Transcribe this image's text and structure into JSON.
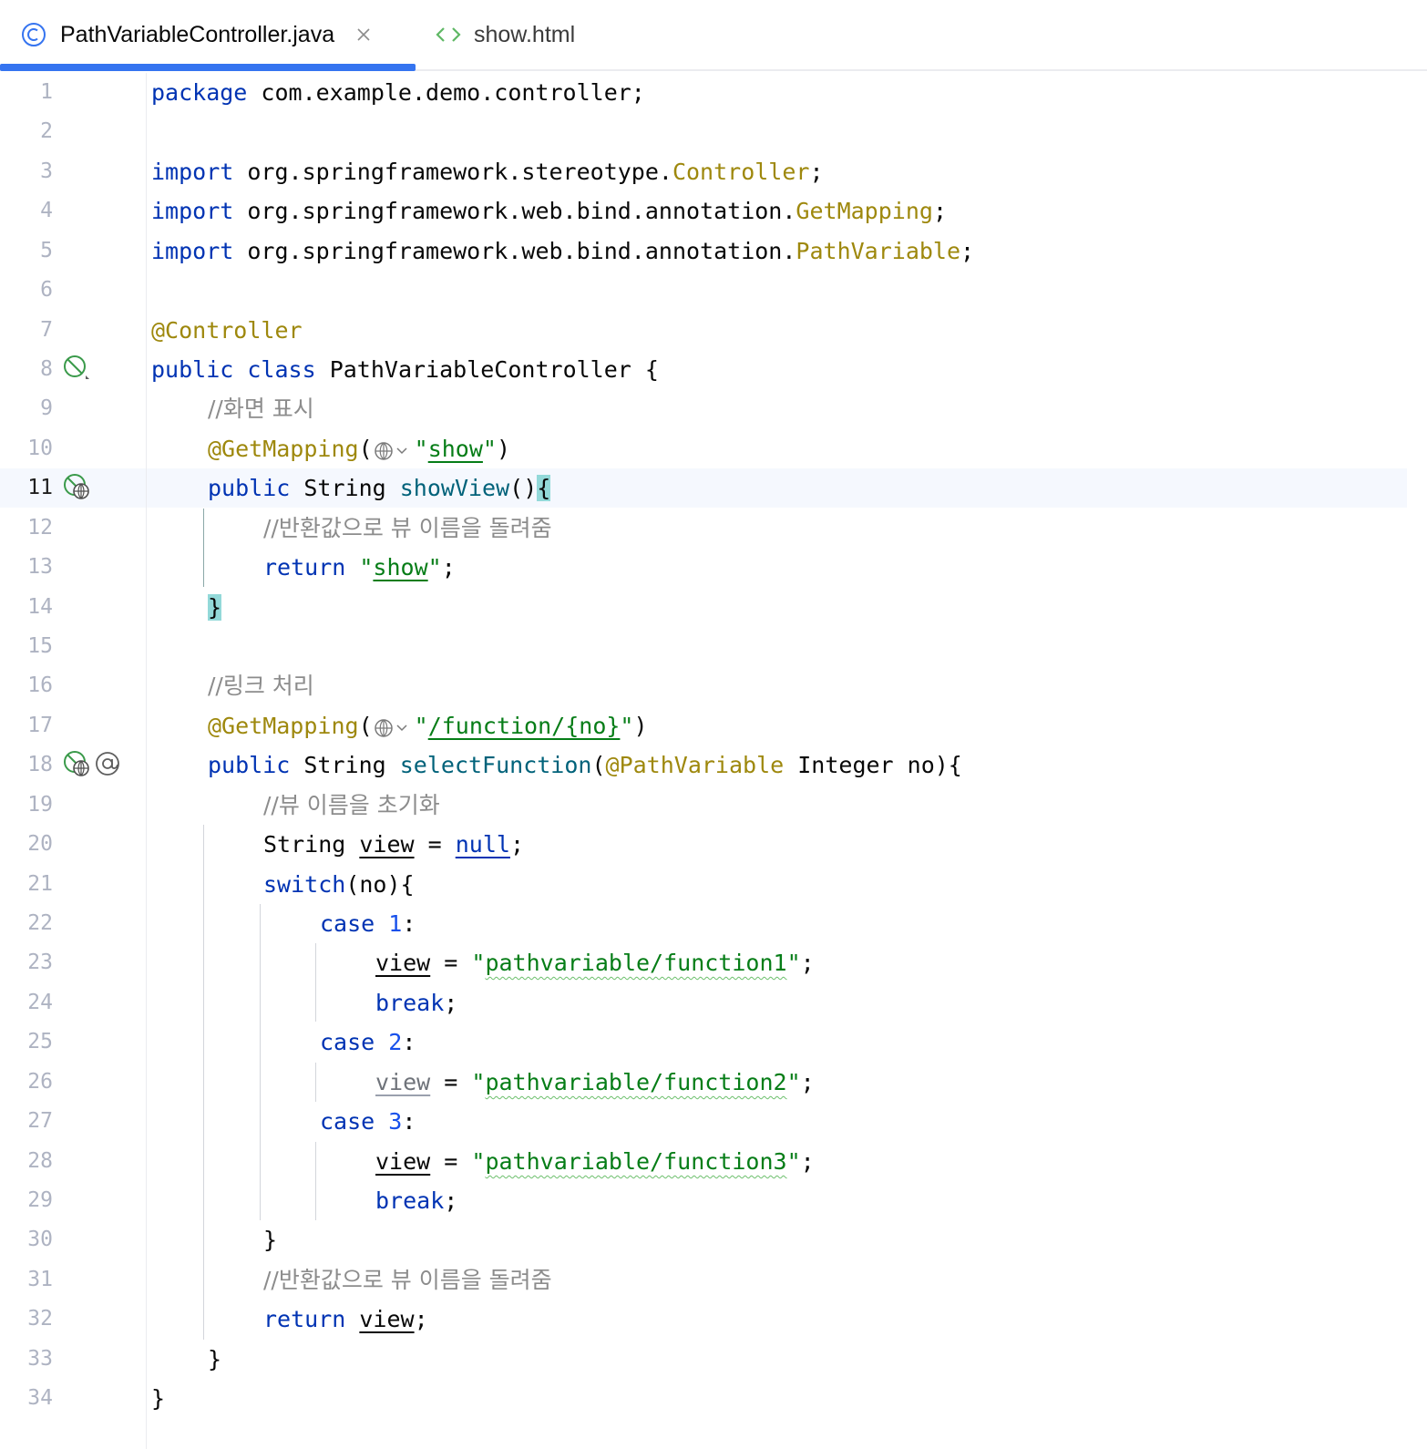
{
  "tabs": [
    {
      "label": "PathVariableController.java",
      "icon": "java-class-icon",
      "active": true
    },
    {
      "label": "show.html",
      "icon": "html-file-icon",
      "active": false
    }
  ],
  "colors": {
    "keyword": "#0033b3",
    "annotation": "#9e880d",
    "string": "#067d17",
    "number": "#1750eb",
    "comment": "#8c8c8c",
    "method": "#00627a",
    "accent": "#3574f0"
  },
  "code": {
    "l1": {
      "kw": "package",
      "rest": " com.example.demo.controller;"
    },
    "l3": {
      "kw": "import",
      "pkg": " org.springframework.stereotype.",
      "cls": "Controller",
      "end": ";"
    },
    "l4": {
      "kw": "import",
      "pkg": " org.springframework.web.bind.annotation.",
      "cls": "GetMapping",
      "end": ";"
    },
    "l5": {
      "kw": "import",
      "pkg": " org.springframework.web.bind.annotation.",
      "cls": "PathVariable",
      "end": ";"
    },
    "l7": {
      "ann": "@Controller"
    },
    "l8": {
      "kw1": "public",
      "kw2": "class",
      "rest": " PathVariableController {"
    },
    "l9": {
      "comment": "//화면 표시"
    },
    "l10": {
      "ann": "@GetMapping",
      "open": "(",
      "q1": "\"",
      "url": "show",
      "q2": "\"",
      "close": ")"
    },
    "l11": {
      "kw": "public",
      "type": " String ",
      "fn": "showView",
      "paren": "()",
      "brace": "{"
    },
    "l12": {
      "comment": "//반환값으로 뷰 이름을 돌려줌"
    },
    "l13": {
      "kw": "return",
      "q1": " \"",
      "val": "show",
      "q2": "\"",
      "end": ";"
    },
    "l14": {
      "brace": "}"
    },
    "l16": {
      "comment": "//링크 처리"
    },
    "l17": {
      "ann": "@GetMapping",
      "open": "(",
      "q1": "\"",
      "url": "/function/{no}",
      "q2": "\"",
      "close": ")"
    },
    "l18": {
      "kw": "public",
      "type": " String ",
      "fn": "selectFunction",
      "open": "(",
      "ann": "@PathVariable",
      "rest": " Integer no){"
    },
    "l19": {
      "comment": "//뷰 이름을 초기화"
    },
    "l20": {
      "type": "String ",
      "var": "view",
      "eq": " = ",
      "null": "null",
      "end": ";"
    },
    "l21": {
      "kw": "switch",
      "rest": "(no){"
    },
    "l22": {
      "kw": "case",
      "num": "1",
      "colon": ":"
    },
    "l23": {
      "var": "view",
      "eq": " = ",
      "q1": "\"",
      "val": "pathvariable/function1",
      "q2": "\"",
      "end": ";"
    },
    "l24": {
      "kw": "break",
      "end": ";"
    },
    "l25": {
      "kw": "case",
      "num": "2",
      "colon": ":"
    },
    "l26": {
      "var": "view",
      "eq": " = ",
      "q1": "\"",
      "val": "pathvariable/function2",
      "q2": "\"",
      "end": ";"
    },
    "l27": {
      "kw": "case",
      "num": "3",
      "colon": ":"
    },
    "l28": {
      "var": "view",
      "eq": " = ",
      "q1": "\"",
      "val": "pathvariable/function3",
      "q2": "\"",
      "end": ";"
    },
    "l29": {
      "kw": "break",
      "end": ";"
    },
    "l30": {
      "brace": "}"
    },
    "l31": {
      "comment": "//반환값으로 뷰 이름을 돌려줌"
    },
    "l32": {
      "kw": "return",
      "var": "view",
      "end": ";"
    },
    "l33": {
      "brace": "}"
    },
    "l34": {
      "brace": "}"
    }
  },
  "line_numbers": [
    "1",
    "2",
    "3",
    "4",
    "5",
    "6",
    "7",
    "8",
    "9",
    "10",
    "11",
    "12",
    "13",
    "14",
    "15",
    "16",
    "17",
    "18",
    "19",
    "20",
    "21",
    "22",
    "23",
    "24",
    "25",
    "26",
    "27",
    "28",
    "29",
    "30",
    "31",
    "32",
    "33",
    "34"
  ],
  "current_line": 11
}
